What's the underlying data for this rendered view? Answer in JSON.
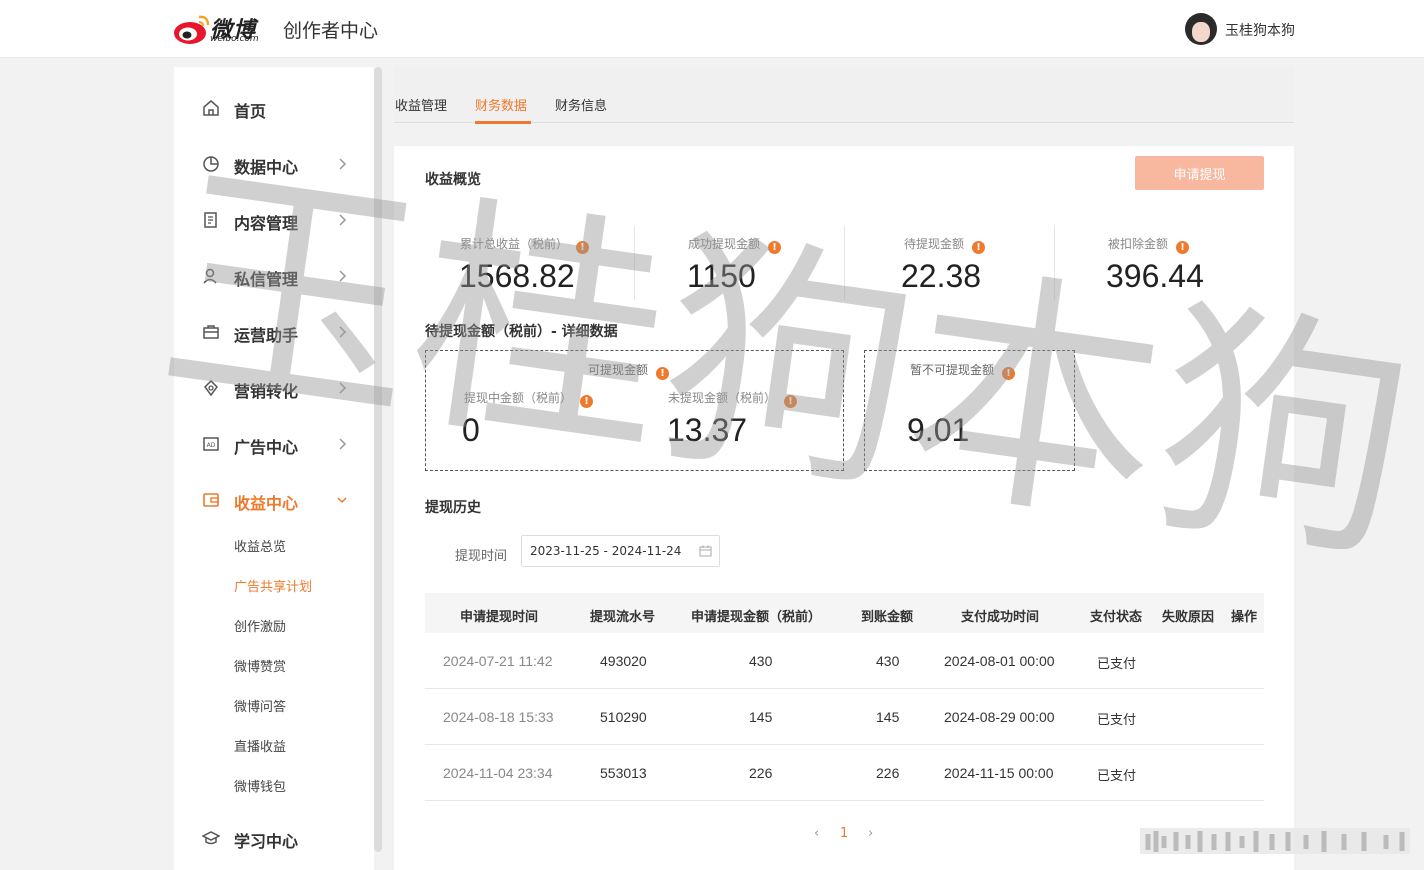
{
  "header": {
    "logo_text": "微博",
    "logo_sub": "weibo.com",
    "app_title": "创作者中心",
    "user_name": "玉桂狗本狗"
  },
  "sidebar": {
    "items": [
      {
        "label": "首页",
        "icon": "home-icon"
      },
      {
        "label": "数据中心",
        "icon": "pie-chart-icon"
      },
      {
        "label": "内容管理",
        "icon": "document-icon"
      },
      {
        "label": "私信管理",
        "icon": "user-message-icon"
      },
      {
        "label": "运营助手",
        "icon": "briefcase-icon"
      },
      {
        "label": "营销转化",
        "icon": "marketing-icon"
      },
      {
        "label": "广告中心",
        "icon": "ad-icon"
      },
      {
        "label": "收益中心",
        "icon": "wallet-icon"
      },
      {
        "label": "学习中心",
        "icon": "graduation-cap-icon"
      }
    ],
    "sub_items": [
      "收益总览",
      "广告共享计划",
      "创作激励",
      "微博赞赏",
      "微博问答",
      "直播收益",
      "微博钱包"
    ]
  },
  "tabs": [
    "收益管理",
    "财务数据",
    "财务信息"
  ],
  "overview": {
    "title": "收益概览",
    "apply_button": "申请提现",
    "stats": [
      {
        "label": "累计总收益（税前）",
        "value": "1568.82"
      },
      {
        "label": "成功提现金额",
        "value": "1150"
      },
      {
        "label": "待提现金额",
        "value": "22.38"
      },
      {
        "label": "被扣除金额",
        "value": "396.44"
      }
    ]
  },
  "detail": {
    "title": "待提现金额（税前）- 详细数据",
    "withdrawable_title": "可提现金额",
    "in_progress_label": "提现中金额（税前）",
    "in_progress_value": "0",
    "not_withdrawn_label": "未提现金额（税前）",
    "not_withdrawn_value": "13.37",
    "unavailable_title": "暂不可提现金额",
    "unavailable_value": "9.01"
  },
  "history": {
    "title": "提现历史",
    "date_label": "提现时间",
    "date_range": "2023-11-25 - 2024-11-24",
    "columns": [
      "申请提现时间",
      "提现流水号",
      "申请提现金额（税前）",
      "到账金额",
      "支付成功时间",
      "支付状态",
      "失败原因",
      "操作"
    ],
    "rows": [
      [
        "2024-07-21 11:42",
        "493020",
        "430",
        "430",
        "2024-08-01 00:00",
        "已支付"
      ],
      [
        "2024-08-18 15:33",
        "510290",
        "145",
        "145",
        "2024-08-29 00:00",
        "已支付"
      ],
      [
        "2024-11-04 23:34",
        "553013",
        "226",
        "226",
        "2024-11-15 00:00",
        "已支付"
      ]
    ],
    "page": "1"
  },
  "watermark_text": "玉桂狗本狗",
  "colors": {
    "accent": "#ee7a2d",
    "button_bg": "#f8b8a0"
  }
}
